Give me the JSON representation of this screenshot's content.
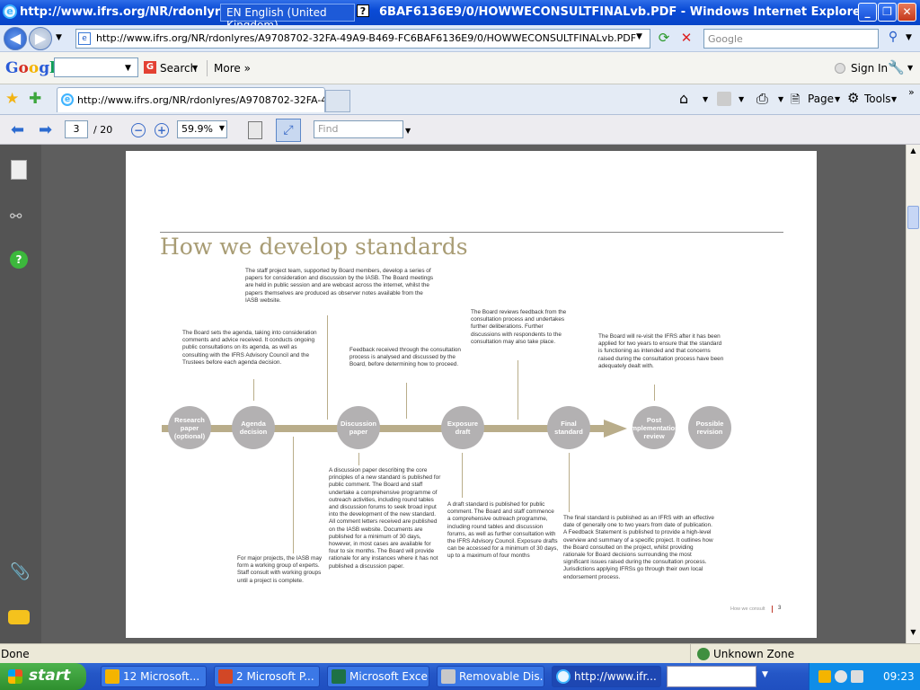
{
  "window": {
    "title": "http://www.ifrs.org/NR/rdonlyres/A9708702-32FA-49A9-B469-FC6BAF6136E9/0/HOWWECONSULTFINALvb.PDF - Windows Internet Explorer",
    "title_left": "http://www.ifrs.org/NR/rdonlyres/A",
    "title_right": "6BAF6136E9/0/HOWWECONSULTFINALvb.PDF - Windows Internet Explorer",
    "language": "EN English (United Kingdom)",
    "help": "?"
  },
  "address": {
    "url": "http://www.ifrs.org/NR/rdonlyres/A9708702-32FA-49A9-B469-FC6BAF6136E9/0/HOWWECONSULTFINALvb.PDF",
    "search_placeholder": "Google"
  },
  "google_toolbar": {
    "logo": "Google",
    "search_label": "Search",
    "more_label": "More »",
    "signin_label": "Sign In"
  },
  "tabs": [
    {
      "label": "http://www.ifrs.org/NR/rdonlyres/A9708702-32FA-4..."
    }
  ],
  "command_bar": {
    "page_label": "Page",
    "tools_label": "Tools"
  },
  "pdf_toolbar": {
    "page": "3",
    "total": "/ 20",
    "zoom": "59.9%",
    "find_placeholder": "Find"
  },
  "document": {
    "title": "How we develop standards",
    "footer": "How we consult",
    "page_number": "3",
    "stages": [
      "Research paper (optional)",
      "Agenda decision",
      "Discussion paper",
      "Exposure draft",
      "Final standard",
      "Post implementation review",
      "Possible revision"
    ],
    "notes": {
      "staff_team": "The staff project team, supported by Board members, develop a series of papers for consideration and discussion by the IASB. The Board meetings are held in public session and are webcast across the internet, whilst the papers themselves are produced as observer notes available from the IASB website.",
      "agenda": "The Board sets the agenda, taking into consideration comments and advice received. It conducts ongoing public consultations on its agenda, as well as consulting with the IFRS Advisory Council and the Trustees before each agenda decision.",
      "feedback": "Feedback received through the consultation process is analysed and discussed by the Board, before determining how to proceed.",
      "board_reviews": "The Board reviews feedback from the consultation process and undertakes further deliberations. Further discussions with respondents to the consultation may also take place.",
      "revisit": "The Board will re-visit the IFRS after it has been applied for two years to ensure that the standard is functioning as intended and that concerns raised during the consultation process have been adequately dealt with.",
      "discussion_paper": "A discussion paper describing the core principles of a new standard is published for public comment. The Board and staff undertake a comprehensive programme of outreach activities, including round tables and discussion forums to seek broad input into the development of the new standard. All comment letters received are published on the IASB website. Documents are published for a minimum of 30 days, however, in most cases are available for four to six months. The Board will provide rationale for any instances where it has not published a discussion paper.",
      "working_group": "For major projects, the IASB may form a working group of experts. Staff consult with working groups until a project is complete.",
      "exposure_draft": "A draft standard is published for public comment. The Board and staff commence a comprehensive outreach programme, including round tables and discussion forums, as well as further consultation with the IFRS Advisory Council. Exposure drafts can be accessed for a minimum of 30 days, up to a maximum of four months",
      "final_standard": "The final standard is published as an IFRS with an effective date of generally one to two years from date of publication. A Feedback Statement is published to provide a high-level overview and summary of a specific project. It outlines how the Board consulted on the project, whilst providing rationale for Board decisions surrounding the most significant issues raised during the consultation process. Jurisdictions applying IFRSs go through their own local endorsement process."
    }
  },
  "status": {
    "left": "Done",
    "zone": "Unknown Zone"
  },
  "taskbar": {
    "start": "start",
    "buttons": [
      "12 Microsoft...",
      "2 Microsoft P...",
      "Microsoft Exce...",
      "Removable Dis...",
      "http://www.ifr..."
    ],
    "clock": "09:23"
  },
  "colors": {
    "accent_gold": "#b9ad8a",
    "title_gold": "#a89c74",
    "circle_grey": "#b3b1b2",
    "xp_blue": "#0a4bd6"
  }
}
